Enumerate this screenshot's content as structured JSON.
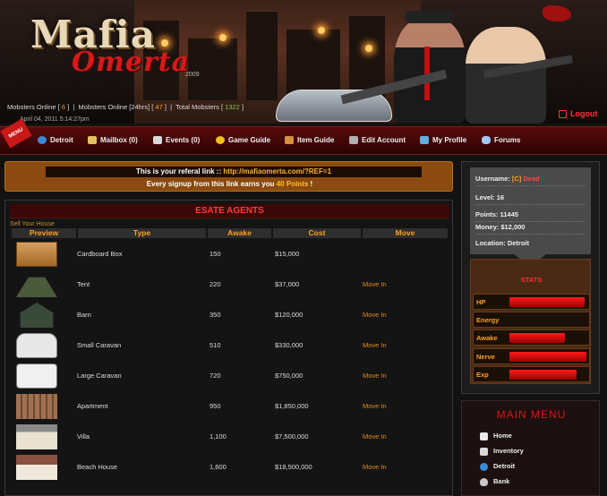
{
  "header": {
    "logo_line1": "Mafia",
    "logo_line2": "Omerta",
    "logo_suffix": "2009",
    "online_label": "Mobsters Online [",
    "online_count": "6",
    "online24_label": "Mobsters Online [24hrs] [",
    "online24_count": "47",
    "total_label": "Total Mobsters [",
    "total_count": "1322",
    "close_bracket": "]",
    "separator": "|",
    "datetime": "April 04, 2011 5:14:27pm",
    "logout_label": "Logout"
  },
  "nav": {
    "badge": "MENU",
    "items": [
      {
        "label": "Detroit",
        "icon": "globe-icon"
      },
      {
        "label": "Mailbox (0)",
        "icon": "envelope-icon"
      },
      {
        "label": "Events (0)",
        "icon": "calendar-icon"
      },
      {
        "label": "Game Guide",
        "icon": "lightbulb-icon"
      },
      {
        "label": "Item Guide",
        "icon": "signpost-icon"
      },
      {
        "label": "Edit Account",
        "icon": "tools-icon"
      },
      {
        "label": "My Profile",
        "icon": "chart-icon"
      },
      {
        "label": "Forums",
        "icon": "speech-bubble-icon"
      }
    ]
  },
  "referral": {
    "prefix": "This is your referal link :: ",
    "link": "http://mafiaomerta.com/?REF=1",
    "line2_prefix": "Every signup from this link earns you ",
    "points": "40 Points",
    "line2_suffix": " !"
  },
  "estate": {
    "title": "ESATE AGENTS",
    "sell_link": "Sell Your House",
    "headers": {
      "preview": "Preview",
      "type": "Type",
      "awake": "Awake",
      "cost": "Cost",
      "move": "Move"
    },
    "rows": [
      {
        "type": "Cardboard Box",
        "awake": "150",
        "cost": "$15,000",
        "move": "",
        "icon": "cardboard-box-icon"
      },
      {
        "type": "Tent",
        "awake": "220",
        "cost": "$37,000",
        "move": "Move In",
        "icon": "tent-icon"
      },
      {
        "type": "Barn",
        "awake": "350",
        "cost": "$120,000",
        "move": "Move In",
        "icon": "barn-icon"
      },
      {
        "type": "Small Caravan",
        "awake": "510",
        "cost": "$330,000",
        "move": "Move In",
        "icon": "caravan-icon"
      },
      {
        "type": "Large Caravan",
        "awake": "720",
        "cost": "$750,000",
        "move": "Move In",
        "icon": "motorhome-icon"
      },
      {
        "type": "Apartment",
        "awake": "950",
        "cost": "$1,850,000",
        "move": "Move In",
        "icon": "apartment-icon"
      },
      {
        "type": "Villa",
        "awake": "1,100",
        "cost": "$7,500,000",
        "move": "Move In",
        "icon": "villa-icon"
      },
      {
        "type": "Beach House",
        "awake": "1,600",
        "cost": "$18,500,000",
        "move": "Move In",
        "icon": "beach-house-icon"
      }
    ]
  },
  "user": {
    "username_label": "Username: ",
    "username_tag": "[C]",
    "username_value": "Dead",
    "level_label": "Level: ",
    "level": "16",
    "points_label": "Points: ",
    "points": "11445",
    "money_label": "Money: ",
    "money": "$12,000",
    "location_label": "Location: ",
    "location": "Detroit"
  },
  "stats": {
    "title": "STATS",
    "items": [
      {
        "label": "HP",
        "level": 0.95
      },
      {
        "label": "Energy",
        "level": 0
      },
      {
        "label": "Awake",
        "level": 0.7
      },
      {
        "label": "Nerve",
        "level": 0.98
      },
      {
        "label": "Exp",
        "level": 0.85
      }
    ]
  },
  "main_menu": {
    "title": "MAIN MENU",
    "items": [
      {
        "label": "Home",
        "icon": "home-icon"
      },
      {
        "label": "Inventory",
        "icon": "inventory-icon"
      },
      {
        "label": "Detroit",
        "icon": "globe-icon"
      },
      {
        "label": "Bank",
        "icon": "money-bag-icon"
      }
    ]
  },
  "colors": {
    "accent_orange": "#ffa020",
    "accent_red": "#d81818",
    "nav_bg": "#5a0a0a"
  }
}
